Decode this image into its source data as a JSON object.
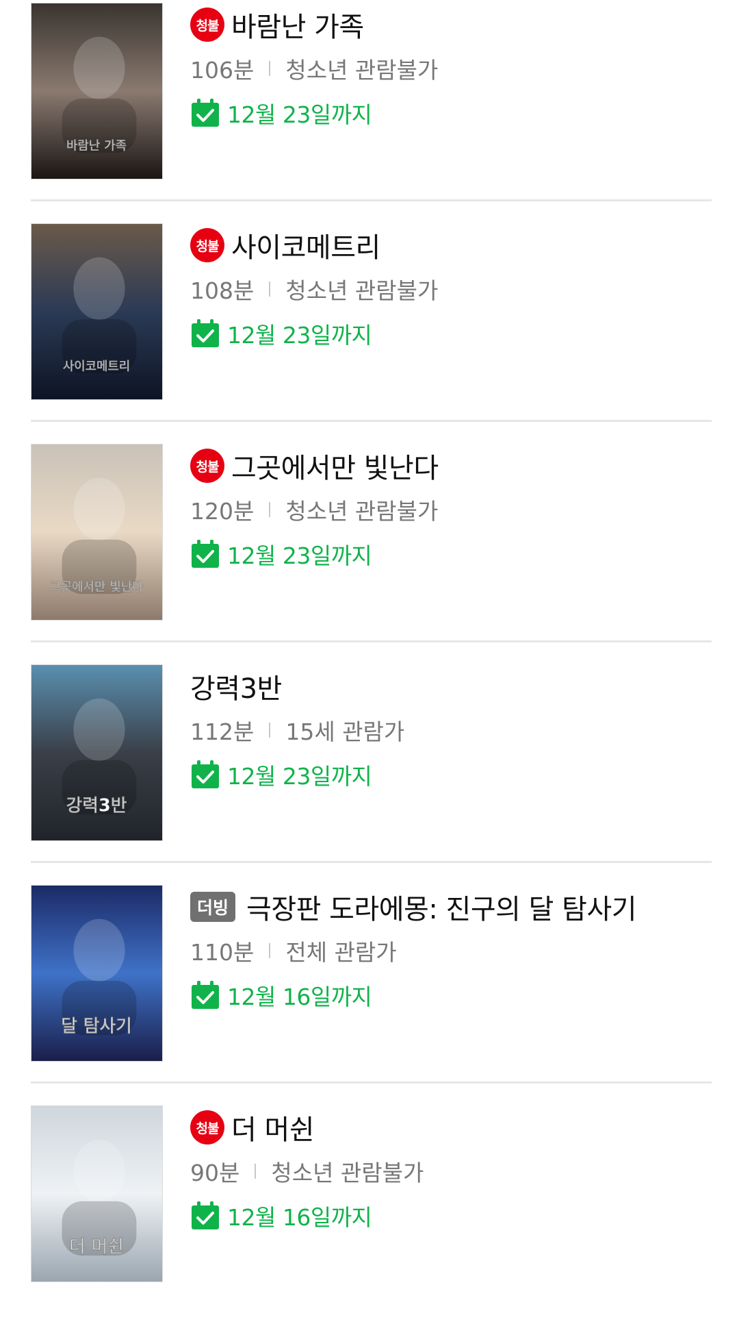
{
  "colors": {
    "restricted_badge": "#e60012",
    "dub_badge": "#707070",
    "date_green": "#10b34a",
    "meta_gray": "#777777",
    "divider": "#e6e6e6"
  },
  "movies": [
    {
      "badge": "청불",
      "badge_type": "restricted",
      "title": "바람난 가족",
      "runtime": "106분",
      "rating": "청소년 관람불가",
      "until": "12월 23일까지",
      "poster_icon": "movie-poster",
      "poster_text": "바람난 가족",
      "poster_colors": [
        "#3a3430",
        "#8a7a70",
        "#1a1614"
      ]
    },
    {
      "badge": "청불",
      "badge_type": "restricted",
      "title": "사이코메트리",
      "runtime": "108분",
      "rating": "청소년 관람불가",
      "until": "12월 23일까지",
      "poster_icon": "movie-poster",
      "poster_text": "사이코메트리",
      "poster_colors": [
        "#6a5a4a",
        "#2b3a55",
        "#0d1424"
      ]
    },
    {
      "badge": "청불",
      "badge_type": "restricted",
      "title": "그곳에서만 빛난다",
      "runtime": "120분",
      "rating": "청소년 관람불가",
      "until": "12월 23일까지",
      "poster_icon": "movie-poster",
      "poster_text": "그곳에서만 빛난다",
      "poster_colors": [
        "#c9c2b8",
        "#e9d9c4",
        "#8d7a6b"
      ]
    },
    {
      "badge": "",
      "badge_type": "none",
      "title": "강력3반",
      "runtime": "112분",
      "rating": "15세 관람가",
      "until": "12월 23일까지",
      "poster_icon": "movie-poster",
      "poster_text": "강력3반",
      "poster_colors": [
        "#5a8fb0",
        "#3a3f48",
        "#20242a"
      ]
    },
    {
      "badge": "더빙",
      "badge_type": "dub",
      "title": "극장판 도라에몽: 진구의 달 탐사기",
      "runtime": "110분",
      "rating": "전체 관람가",
      "until": "12월 16일까지",
      "poster_icon": "movie-poster",
      "poster_text": "달 탐사기",
      "poster_colors": [
        "#1c2a66",
        "#3f72c8",
        "#1a1f4a"
      ]
    },
    {
      "badge": "청불",
      "badge_type": "restricted",
      "title": "더 머쉰",
      "runtime": "90분",
      "rating": "청소년 관람불가",
      "until": "12월 16일까지",
      "poster_icon": "movie-poster",
      "poster_text": "더 머쉰",
      "poster_colors": [
        "#cfd6dc",
        "#eef2f5",
        "#9aa6b0"
      ]
    }
  ]
}
